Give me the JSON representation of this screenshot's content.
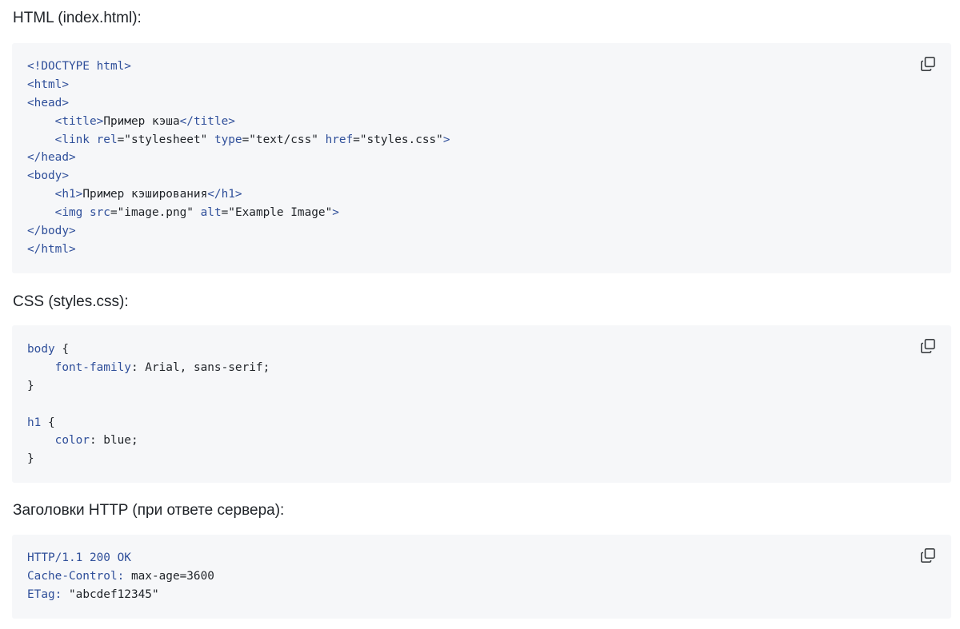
{
  "sections": [
    {
      "heading": "HTML (index.html):",
      "copy_icon": "copy-icon",
      "lines": [
        [
          [
            "tag",
            "<!DOCTYPE html>"
          ]
        ],
        [
          [
            "tag",
            "<html>"
          ]
        ],
        [
          [
            "tag",
            "<head>"
          ]
        ],
        [
          [
            "plain",
            "    "
          ],
          [
            "tag",
            "<title>"
          ],
          [
            "plain",
            "Пример кэша"
          ],
          [
            "tag",
            "</title>"
          ]
        ],
        [
          [
            "plain",
            "    "
          ],
          [
            "tag",
            "<link "
          ],
          [
            "attr",
            "rel"
          ],
          [
            "plain",
            "=\"stylesheet\" "
          ],
          [
            "attr",
            "type"
          ],
          [
            "plain",
            "=\"text/css\" "
          ],
          [
            "attr",
            "href"
          ],
          [
            "plain",
            "=\"styles.css\""
          ],
          [
            "tag",
            ">"
          ]
        ],
        [
          [
            "tag",
            "</head>"
          ]
        ],
        [
          [
            "tag",
            "<body>"
          ]
        ],
        [
          [
            "plain",
            "    "
          ],
          [
            "tag",
            "<h1>"
          ],
          [
            "plain",
            "Пример кэширования"
          ],
          [
            "tag",
            "</h1>"
          ]
        ],
        [
          [
            "plain",
            "    "
          ],
          [
            "tag",
            "<img "
          ],
          [
            "attr",
            "src"
          ],
          [
            "plain",
            "=\"image.png\" "
          ],
          [
            "attr",
            "alt"
          ],
          [
            "plain",
            "=\"Example Image\""
          ],
          [
            "tag",
            ">"
          ]
        ],
        [
          [
            "tag",
            "</body>"
          ]
        ],
        [
          [
            "tag",
            "</html>"
          ]
        ]
      ]
    },
    {
      "heading": "CSS (styles.css):",
      "copy_icon": "copy-icon",
      "lines": [
        [
          [
            "kw",
            "body"
          ],
          [
            "plain",
            " {"
          ]
        ],
        [
          [
            "plain",
            "    "
          ],
          [
            "kw",
            "font-family"
          ],
          [
            "plain",
            ": Arial, sans-serif;"
          ]
        ],
        [
          [
            "plain",
            "}"
          ]
        ],
        [
          [
            "plain",
            ""
          ]
        ],
        [
          [
            "kw",
            "h1"
          ],
          [
            "plain",
            " {"
          ]
        ],
        [
          [
            "plain",
            "    "
          ],
          [
            "kw",
            "color"
          ],
          [
            "plain",
            ": blue;"
          ]
        ],
        [
          [
            "plain",
            "}"
          ]
        ]
      ]
    },
    {
      "heading": "Заголовки HTTP (при ответе сервера):",
      "copy_icon": "copy-icon",
      "lines": [
        [
          [
            "kw",
            "HTTP/1.1 200 OK"
          ]
        ],
        [
          [
            "kw",
            "Cache-Control:"
          ],
          [
            "plain",
            " max-age=3600"
          ]
        ],
        [
          [
            "kw",
            "ETag:"
          ],
          [
            "plain",
            " \"abcdef12345\""
          ]
        ]
      ]
    }
  ],
  "colors": {
    "code_background": "#f6f7f9",
    "token_blue": "#2f4f9a",
    "text": "#1f2328"
  }
}
